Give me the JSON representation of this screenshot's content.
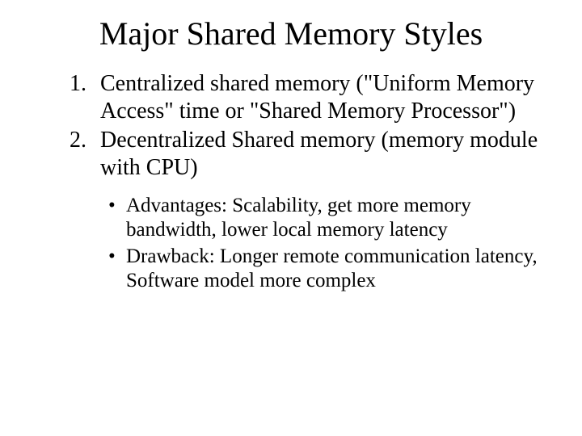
{
  "title": "Major Shared Memory Styles",
  "items": [
    {
      "num": "1.",
      "text": "Centralized shared memory (\"Uniform Memory Access\" time or \"Shared Memory Processor\")"
    },
    {
      "num": "2.",
      "text": "Decentralized Shared memory (memory module with CPU)"
    }
  ],
  "subitems": [
    {
      "text": "Advantages: Scalability, get more memory bandwidth, lower local memory latency"
    },
    {
      "text": "Drawback: Longer remote communication latency, Software model more complex"
    }
  ]
}
